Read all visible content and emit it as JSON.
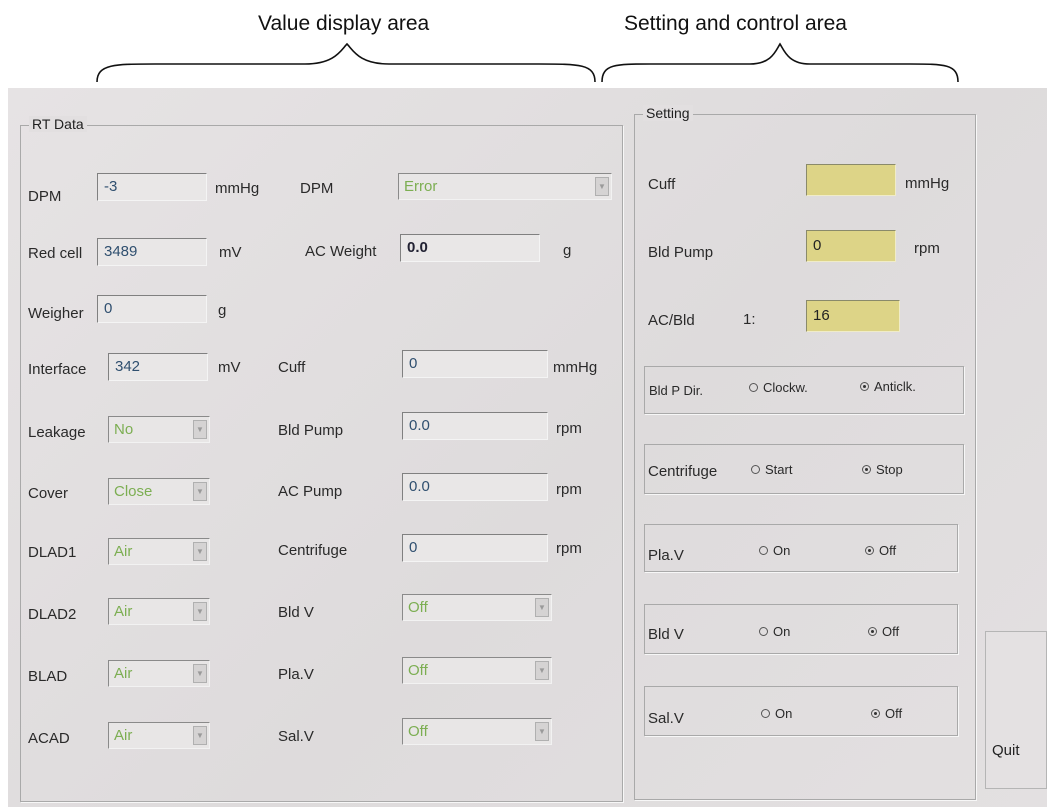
{
  "annotations": {
    "value_area": "Value display area",
    "setting_area": "Setting and control area"
  },
  "rt": {
    "title": "RT Data",
    "dpm": {
      "label": "DPM",
      "value": "-3",
      "unit": "mmHg"
    },
    "dpm_status": {
      "label": "DPM",
      "value": "Error"
    },
    "red_cell": {
      "label": "Red cell",
      "value": "3489",
      "unit": "mV"
    },
    "ac_weight": {
      "label": "AC Weight",
      "value": "0.0",
      "unit": "g"
    },
    "weigher": {
      "label": "Weigher",
      "value": "0",
      "unit": "g"
    },
    "interface": {
      "label": "Interface",
      "value": "342",
      "unit": "mV"
    },
    "cuff": {
      "label": "Cuff",
      "value": "0",
      "unit": "mmHg"
    },
    "leakage": {
      "label": "Leakage",
      "value": "No"
    },
    "bld_pump": {
      "label": "Bld Pump",
      "value": "0.0",
      "unit": "rpm"
    },
    "cover": {
      "label": "Cover",
      "value": "Close"
    },
    "ac_pump": {
      "label": "AC Pump",
      "value": "0.0",
      "unit": "rpm"
    },
    "dlad1": {
      "label": "DLAD1",
      "value": "Air"
    },
    "centrifuge": {
      "label": "Centrifuge",
      "value": "0",
      "unit": "rpm"
    },
    "dlad2": {
      "label": "DLAD2",
      "value": "Air"
    },
    "bld_v": {
      "label": "Bld V",
      "value": "Off"
    },
    "blad": {
      "label": "BLAD",
      "value": "Air"
    },
    "pla_v": {
      "label": "Pla.V",
      "value": "Off"
    },
    "acad": {
      "label": "ACAD",
      "value": "Air"
    },
    "sal_v": {
      "label": "Sal.V",
      "value": "Off"
    }
  },
  "setting": {
    "title": "Setting",
    "cuff": {
      "label": "Cuff",
      "value": "",
      "unit": "mmHg"
    },
    "bld_pump": {
      "label": "Bld Pump",
      "value": "0",
      "unit": "rpm"
    },
    "ac_bld": {
      "label": "AC/Bld",
      "ratio": "1:",
      "value": "16"
    },
    "bld_p_dir": {
      "label": "Bld P Dir.",
      "opt1": "Clockw.",
      "opt2": "Anticlk.",
      "selected": "Anticlk."
    },
    "centrifuge": {
      "label": "Centrifuge",
      "opt1": "Start",
      "opt2": "Stop",
      "selected": "Stop"
    },
    "pla_v": {
      "label": "Pla.V",
      "opt1": "On",
      "opt2": "Off",
      "selected": "Off"
    },
    "bld_v": {
      "label": "Bld V",
      "opt1": "On",
      "opt2": "Off",
      "selected": "Off"
    },
    "sal_v": {
      "label": "Sal.V",
      "opt1": "On",
      "opt2": "Off",
      "selected": "Off"
    }
  },
  "quit_label": "Quit"
}
